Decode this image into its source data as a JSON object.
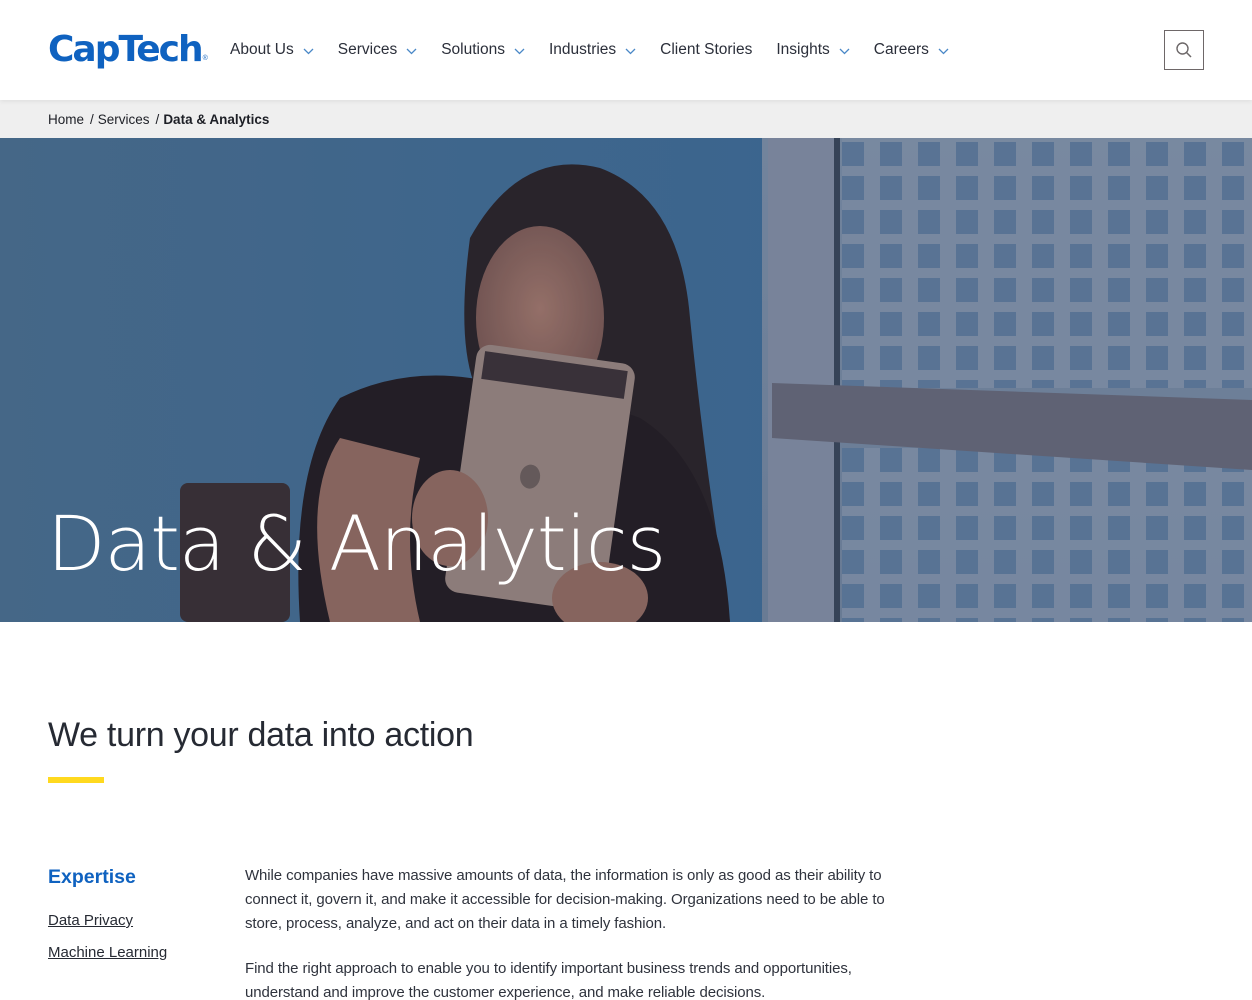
{
  "header": {
    "logo_text": "CapTech",
    "logo_mark": "®",
    "nav": [
      {
        "label": "About Us",
        "has_dropdown": true
      },
      {
        "label": "Services",
        "has_dropdown": true
      },
      {
        "label": "Solutions",
        "has_dropdown": true
      },
      {
        "label": "Industries",
        "has_dropdown": true
      },
      {
        "label": "Client Stories",
        "has_dropdown": false
      },
      {
        "label": "Insights",
        "has_dropdown": true
      },
      {
        "label": "Careers",
        "has_dropdown": true
      }
    ],
    "search_icon": "search-icon"
  },
  "breadcrumb": {
    "items": [
      {
        "label": "Home"
      },
      {
        "label": "Services"
      }
    ],
    "separator": "/",
    "current": "Data & Analytics"
  },
  "hero": {
    "title": "Data & Analytics",
    "image_description": "Woman smiling at a tablet in an office with city buildings through window"
  },
  "main": {
    "section_title": "We turn your data into action",
    "sidebar": {
      "heading": "Expertise",
      "links": [
        "Data Privacy",
        "Machine Learning"
      ]
    },
    "paragraphs": [
      "While companies have massive amounts of data, the information is only as good as their ability to connect it, govern it, and make it accessible for decision-making. Organizations need to be able to store, process, analyze, and act on their data in a timely fashion.",
      "Find the right approach to enable you to identify important business trends and opportunities, understand and improve the customer experience, and make reliable decisions."
    ]
  },
  "colors": {
    "brand_blue": "#0f62c0",
    "accent_yellow": "#ffd91f",
    "nav_chevron": "#4a88c7",
    "breadcrumb_bg": "#efefef",
    "hero_overlay": "#4c6f8f"
  }
}
